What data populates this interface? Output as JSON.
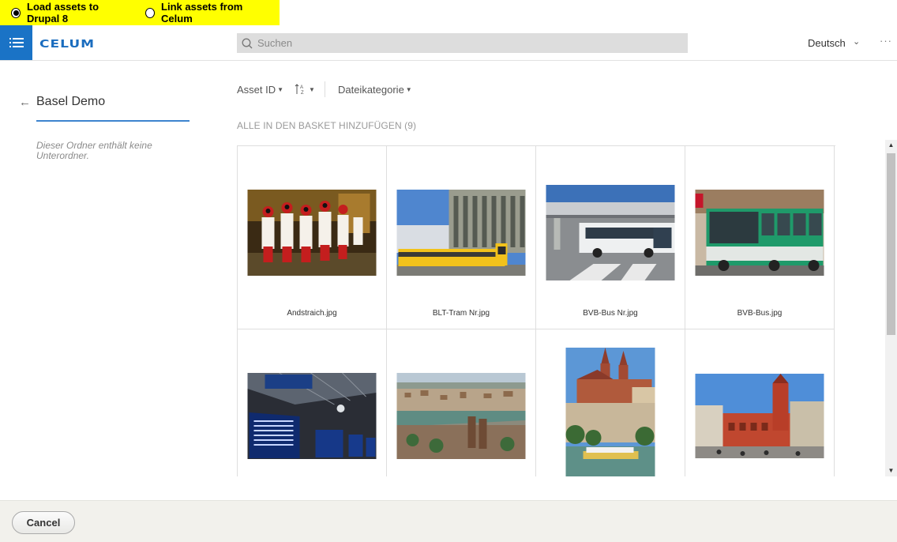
{
  "mode_options": [
    {
      "label": "Load assets to Drupal 8",
      "selected": true
    },
    {
      "label": "Link assets from Celum",
      "selected": false
    }
  ],
  "header": {
    "logo": "CELUM",
    "search_placeholder": "Suchen",
    "language": "Deutsch",
    "more": "···"
  },
  "sidebar": {
    "folder_title": "Basel Demo",
    "empty_message": "Dieser Ordner enthält keine Unterordner."
  },
  "toolbar": {
    "sort_field": "Asset ID",
    "sort_icon": "↑A Z",
    "category_filter": "Dateikategorie"
  },
  "add_all_label": "ALLE IN DEN BASKET HINZUFÜGEN (9)",
  "assets": [
    {
      "name": "Andstraich.jpg"
    },
    {
      "name": "BLT-Tram Nr.jpg"
    },
    {
      "name": "BVB-Bus Nr.jpg"
    },
    {
      "name": "BVB-Bus.jpg"
    },
    {
      "name": ""
    },
    {
      "name": ""
    },
    {
      "name": ""
    },
    {
      "name": ""
    }
  ],
  "footer": {
    "cancel_label": "Cancel"
  }
}
